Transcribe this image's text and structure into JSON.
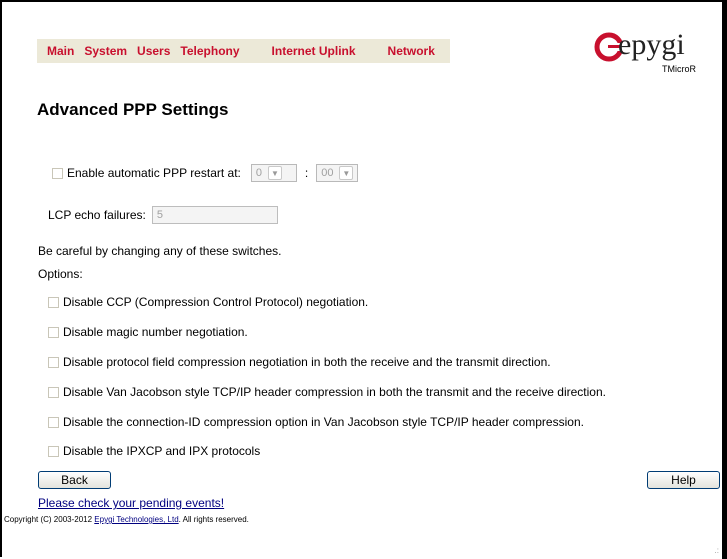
{
  "nav": {
    "items": [
      {
        "label": "Main"
      },
      {
        "label": "System"
      },
      {
        "label": "Users"
      },
      {
        "label": "Telephony"
      },
      {
        "label": "Internet Uplink"
      },
      {
        "label": "Network"
      }
    ]
  },
  "logo": {
    "text": "epygi",
    "sub": "TMicroR",
    "brand_color": "#c8102e"
  },
  "page": {
    "title": "Advanced PPP Settings"
  },
  "restart": {
    "label": "Enable automatic PPP restart at:",
    "hour": "0",
    "colon": ":",
    "minute": "00",
    "checked": false
  },
  "lcp": {
    "label": "LCP echo failures:",
    "value": "5"
  },
  "warning": "Be careful by changing any of these switches.",
  "options_label": "Options:",
  "options": [
    {
      "label": "Disable CCP (Compression Control Protocol) negotiation."
    },
    {
      "label": "Disable magic number negotiation."
    },
    {
      "label": "Disable protocol field compression negotiation in both the receive and the transmit direction."
    },
    {
      "label": "Disable Van Jacobson style TCP/IP header compression in both the transmit and the receive direction."
    },
    {
      "label": "Disable the connection-ID compression option in Van Jacobson style TCP/IP header compression."
    },
    {
      "label": "Disable the IPXCP and IPX protocols"
    }
  ],
  "buttons": {
    "back": "Back",
    "help": "Help"
  },
  "footer": {
    "pending_link": "Please check your pending events!",
    "copyright_prefix": "Copyright (C) 2003-2012 ",
    "company_link": "Epygi Technologies, Ltd",
    "copyright_suffix": ". All rights reserved."
  }
}
